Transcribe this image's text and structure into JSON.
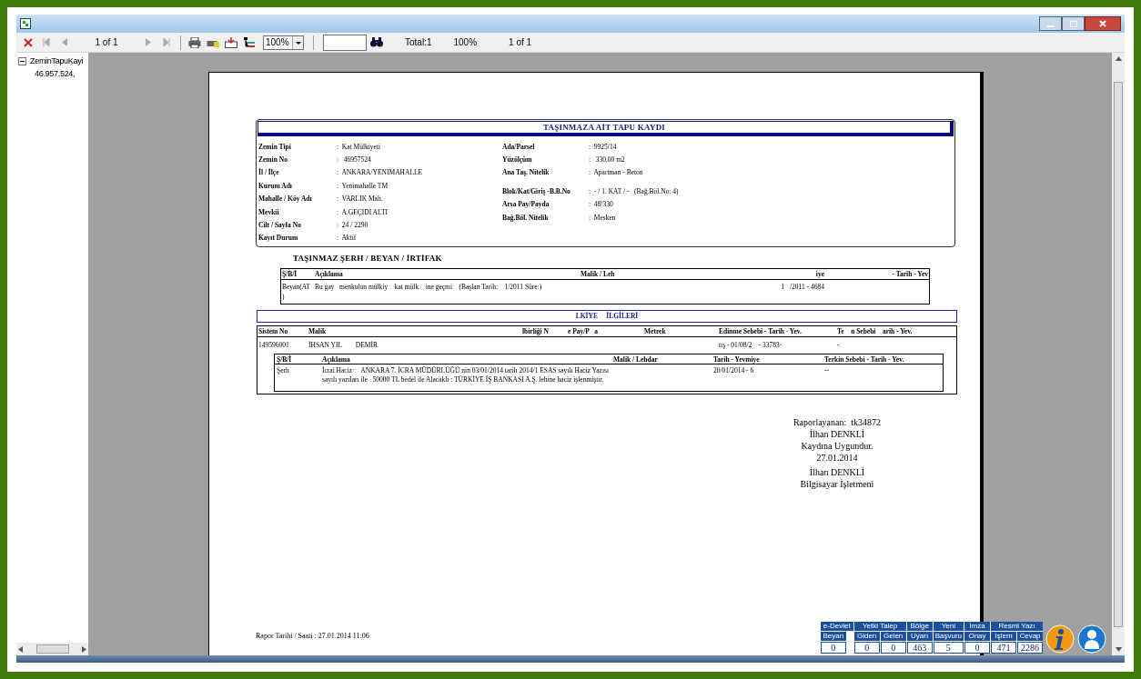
{
  "toolbar": {
    "page_label": "1 of 1",
    "zoom": "100%",
    "total": "Total:1",
    "zoom_status": "100%",
    "page_status": "1 of 1"
  },
  "tree": [
    {
      "label": "ZeminTapuKayi",
      "expanded": true,
      "children": [
        {
          "label": "46.957.524,"
        }
      ]
    }
  ],
  "report": {
    "title": "TAŞINMAZA AİT TAPU KAYDI",
    "left_fields": [
      {
        "label": "Zemin Tipi",
        "value": ":  Kat Mülkiyeti"
      },
      {
        "label": "Zemin No",
        "value": ":   46957524"
      },
      {
        "label": "İl / İlçe",
        "value": ":  ANKARA/YENIMAHALLE"
      },
      {
        "label": "Kurum Adı",
        "value": ":  Yenimahalle TM"
      },
      {
        "label": "Mahalle / Köy Adı",
        "value": ":  VARLIK Mah."
      },
      {
        "label": "Mevkii",
        "value": ":  A.GEÇIDI ALTI"
      },
      {
        "label": "Cilt / Sayfa No",
        "value": ":  24 / 2290"
      },
      {
        "label": "Kayıt Durum",
        "value": ":  Aktif"
      }
    ],
    "right_fields": [
      {
        "label": "Ada/Parsel",
        "value": ":  9925/14"
      },
      {
        "label": "Yüzölçüm",
        "value": ":   330,00 m2"
      },
      {
        "label": "Ana Taş. Nitelik",
        "value": ":  Apartman - Beton"
      },
      {
        "label": "Blok/Kat/Giriş -B.B.No",
        "value": ":  - / 1. KAT / -   (Bağ.Böl.No: 4)"
      },
      {
        "label": "Arsa Pay/Payda",
        "value": ":  48/330"
      },
      {
        "label": "Bağ.Böl. Nitelik",
        "value": ":  Mesken"
      }
    ],
    "serh_title": "TAŞINMAZ ŞERH / BEYAN / İRTİFAK",
    "serh_columns": [
      "Ş/B/İ",
      "Açıklama",
      "Malik / Leh",
      "iye",
      "- Tarih - Yev"
    ],
    "serh_rows": [
      [
        "Beyan(AT )",
        "Bu gay   menkulun mülkiy    kat mülk    ine geçmi    (Başlan Tarih:    1/2011 Süre:)",
        "",
        "1   /2011 - 4684",
        ""
      ]
    ],
    "mulkiyet_title": "LKİYE     İLGİLERİ",
    "mulkiyet_columns": [
      "Sistem No",
      "Malik",
      "lbirliği N",
      "e Pay/P   a",
      "Metrek",
      "Edinme Sebebi - Tarih - Yev.",
      "Te    n Sebebi    arih - Yev."
    ],
    "mulkiyet_rows": [
      [
        "149596001",
        "İHSAN YIL        DEMİR",
        "",
        "",
        "",
        "tış - 01/08/2    - 33783-",
        "-"
      ]
    ],
    "sub_columns": [
      "Ş/B/İ",
      "Açıklama",
      "Malik / Lehdar",
      "Tarih - Yevmiye",
      "Terkin Sebebi - Tarih - Yev."
    ],
    "sub_rows": [
      [
        "Şerh",
        "İcrai Haciz :   ANKARA 7. İCRA MÜDÜRLÜĞÜ nin 03/01/2014 tarih 2014/1 ESAS sayılı Haciz Yazısı sayılı yazıları ile   50000 TL bedel ile Alacaklı : TÜRKİYE İŞ BANKASI A.Ş. lehine haciz işlenmiştir.",
        "",
        "20/01/2014 - 6",
        "--"
      ]
    ],
    "signature": [
      "Raporlayanan:  tk34872",
      "İlhan DENKLİ",
      "Kaydına Uygundur.",
      "27.01.2014",
      "İlhan DENKLİ",
      "Bilgisayar İşletmeni"
    ],
    "footer": "Rapor Tarihi / Saati : 27.01.2014  11:06"
  },
  "counters": [
    {
      "label": "e-Devlet",
      "items": [
        {
          "label": "Beyan",
          "value": "0"
        }
      ]
    },
    {
      "label": "Yetki Talep",
      "items": [
        {
          "label": "Giden",
          "value": "0"
        },
        {
          "label": "Gelen",
          "value": "0"
        }
      ]
    },
    {
      "label": "Bölge",
      "items": [
        {
          "label": "Uyarı",
          "value": "463"
        }
      ]
    },
    {
      "label": "Yeni",
      "items": [
        {
          "label": "Başvuru",
          "value": "5"
        }
      ]
    },
    {
      "label": "İmza",
      "items": [
        {
          "label": "Onay",
          "value": "0"
        }
      ]
    },
    {
      "label": "Resmi Yazı",
      "items": [
        {
          "label": "İşlem",
          "value": "471"
        },
        {
          "label": "Cevap",
          "value": "2286"
        }
      ]
    }
  ]
}
